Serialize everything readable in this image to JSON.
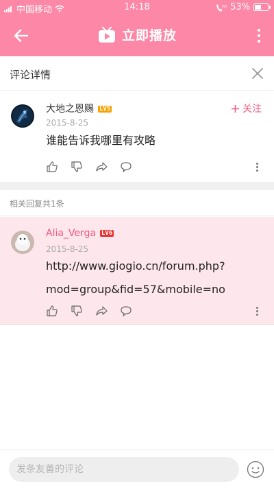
{
  "status_bar": {
    "carrier": "中国移动",
    "time": "14:18",
    "battery": "53%",
    "battery_level": 0.53
  },
  "app_bar": {
    "title": "立即播放"
  },
  "detail": {
    "title": "评论详情"
  },
  "main_comment": {
    "username": "大地之恩赐",
    "level": "LV5",
    "date": "2015-8-25",
    "text": "谁能告诉我哪里有攻略",
    "follow_label": "关注"
  },
  "related": {
    "label": "相关回复共1条"
  },
  "reply": {
    "username": "Alia_Verga",
    "level": "LV6",
    "date": "2015-8-25",
    "text_line1": "http://www.giogio.cn/forum.php?",
    "text_line2": "mod=group&fid=57&mobile=no"
  },
  "bottom_bar": {
    "placeholder": "发条友善的评论"
  },
  "colors": {
    "accent": "#fc87a7",
    "follow": "#f1577f",
    "reply_bg": "#fde6ec",
    "lv5": "#f5a300",
    "lv6": "#e8302f"
  }
}
